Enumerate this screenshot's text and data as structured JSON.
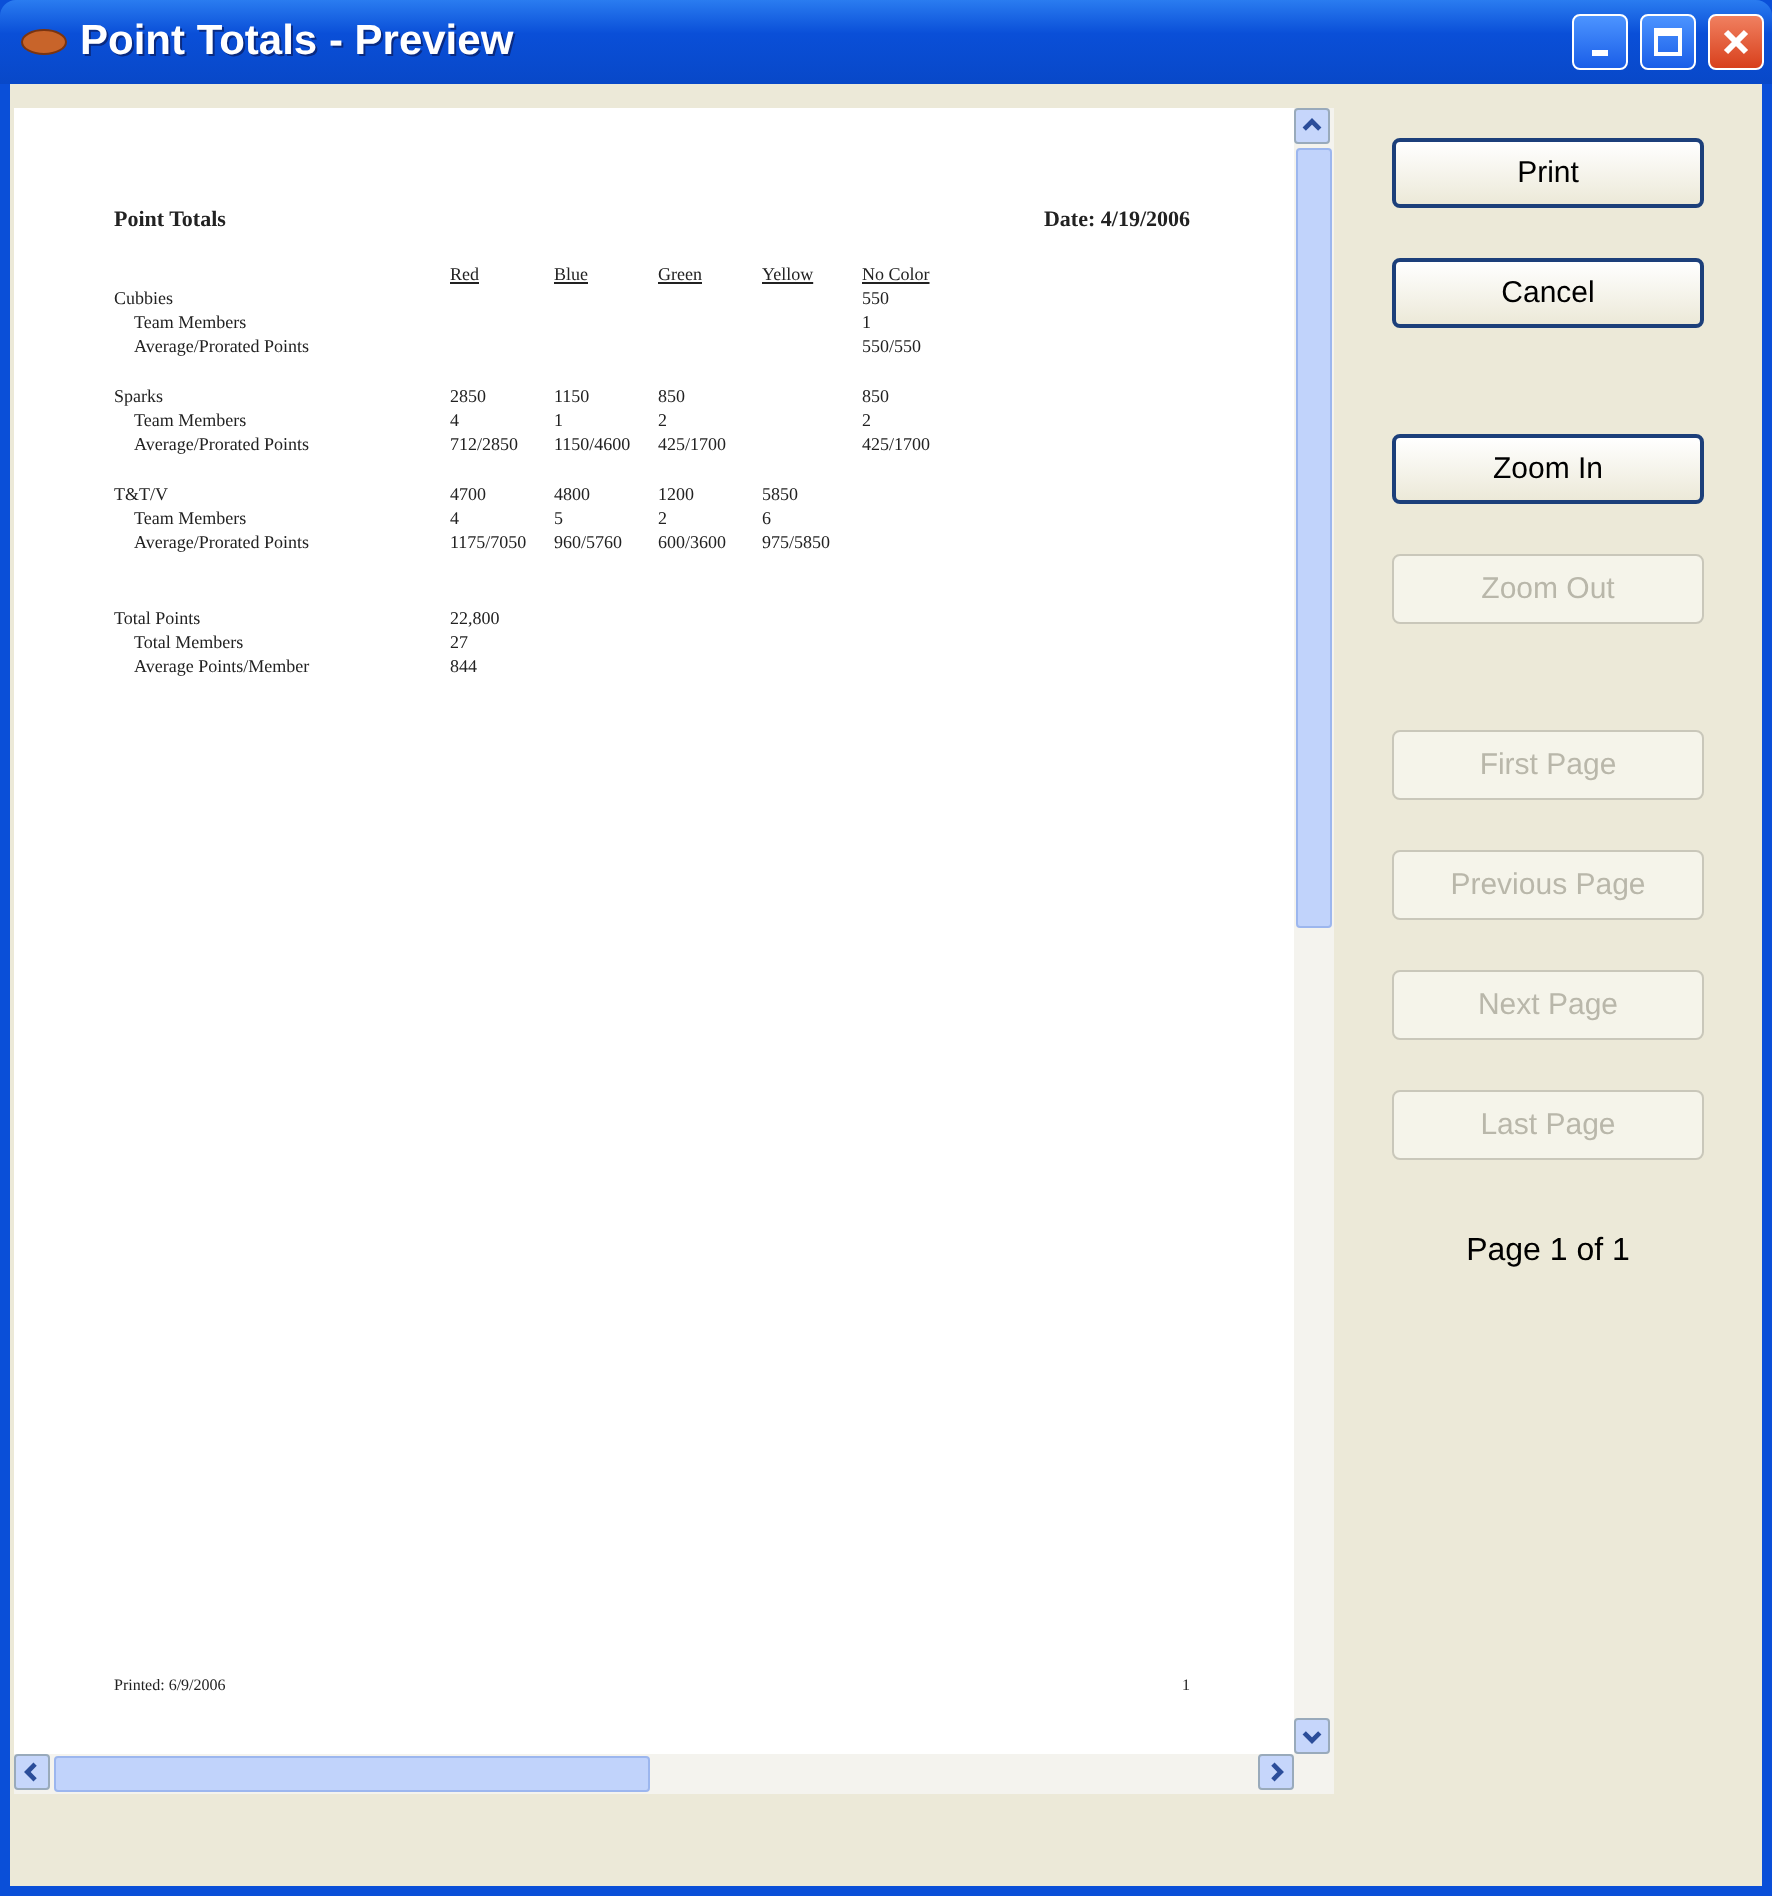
{
  "window": {
    "title": "Point Totals - Preview"
  },
  "report": {
    "title": "Point Totals",
    "date": "Date: 4/19/2006",
    "columns": [
      "Red",
      "Blue",
      "Green",
      "Yellow",
      "No Color"
    ],
    "groups": [
      {
        "name": "Cubbies",
        "cells": [
          null,
          null,
          null,
          null,
          "550"
        ],
        "rows": [
          {
            "label": "Team Members",
            "cells": [
              null,
              null,
              null,
              null,
              "1"
            ]
          },
          {
            "label": "Average/Prorated Points",
            "cells": [
              null,
              null,
              null,
              null,
              "550/550"
            ]
          }
        ]
      },
      {
        "name": "Sparks",
        "cells": [
          "2850",
          "1150",
          "850",
          null,
          "850"
        ],
        "rows": [
          {
            "label": "Team Members",
            "cells": [
              "4",
              "1",
              "2",
              null,
              "2"
            ]
          },
          {
            "label": "Average/Prorated Points",
            "cells": [
              "712/2850",
              "1150/4600",
              "425/1700",
              null,
              "425/1700"
            ]
          }
        ]
      },
      {
        "name": "T&T/V",
        "cells": [
          "4700",
          "4800",
          "1200",
          "5850",
          null
        ],
        "rows": [
          {
            "label": "Team Members",
            "cells": [
              "4",
              "5",
              "2",
              "6",
              null
            ]
          },
          {
            "label": "Average/Prorated Points",
            "cells": [
              "1175/7050",
              "960/5760",
              "600/3600",
              "975/5850",
              null
            ]
          }
        ]
      }
    ],
    "totals": [
      {
        "label": "Total Points",
        "value": "22,800"
      },
      {
        "label": "Total Members",
        "value": "27"
      },
      {
        "label": "Average Points/Member",
        "value": "844"
      }
    ],
    "footer": {
      "printed": "Printed: 6/9/2006",
      "page": "1"
    }
  },
  "button_groups": [
    [
      {
        "label": "Print",
        "disabled": false
      },
      {
        "label": "Cancel",
        "disabled": false
      }
    ],
    [
      {
        "label": "Zoom In",
        "disabled": false
      },
      {
        "label": "Zoom Out",
        "disabled": true
      }
    ],
    [
      {
        "label": "First Page",
        "disabled": true
      },
      {
        "label": "Previous Page",
        "disabled": true
      },
      {
        "label": "Next Page",
        "disabled": true
      },
      {
        "label": "Last Page",
        "disabled": true
      }
    ]
  ],
  "page_label": "Page 1 of 1"
}
